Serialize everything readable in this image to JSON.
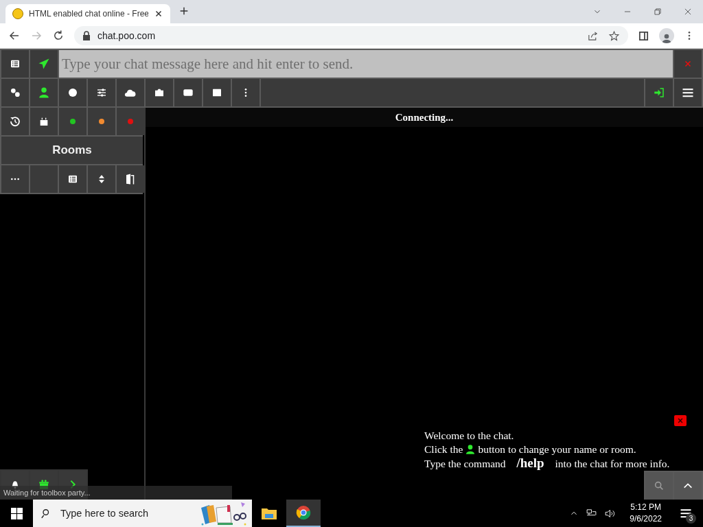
{
  "browser": {
    "tab_title": "HTML enabled chat online - Free",
    "url": "chat.poo.com"
  },
  "composer": {
    "placeholder": "Type your chat message here and hit enter to send."
  },
  "status_dots": [
    {
      "color": "#22c422"
    },
    {
      "color": "#f08a30"
    },
    {
      "color": "#e01010"
    }
  ],
  "rooms_label": "Rooms",
  "chat": {
    "status": "Connecting...",
    "messages": [
      {
        "kind": "text",
        "text": "Welcome to the chat."
      },
      {
        "kind": "icon_text",
        "before": "Click the",
        "after": "button to change your name or room."
      },
      {
        "kind": "text",
        "text": "Type the command **/help** into the chat for more info."
      }
    ]
  },
  "status_tooltip": "Waiting for toolbox party...",
  "taskbar": {
    "search_placeholder": "Type here to search",
    "time": "5:12 PM",
    "date": "9/6/2022",
    "notification_count": "3"
  }
}
